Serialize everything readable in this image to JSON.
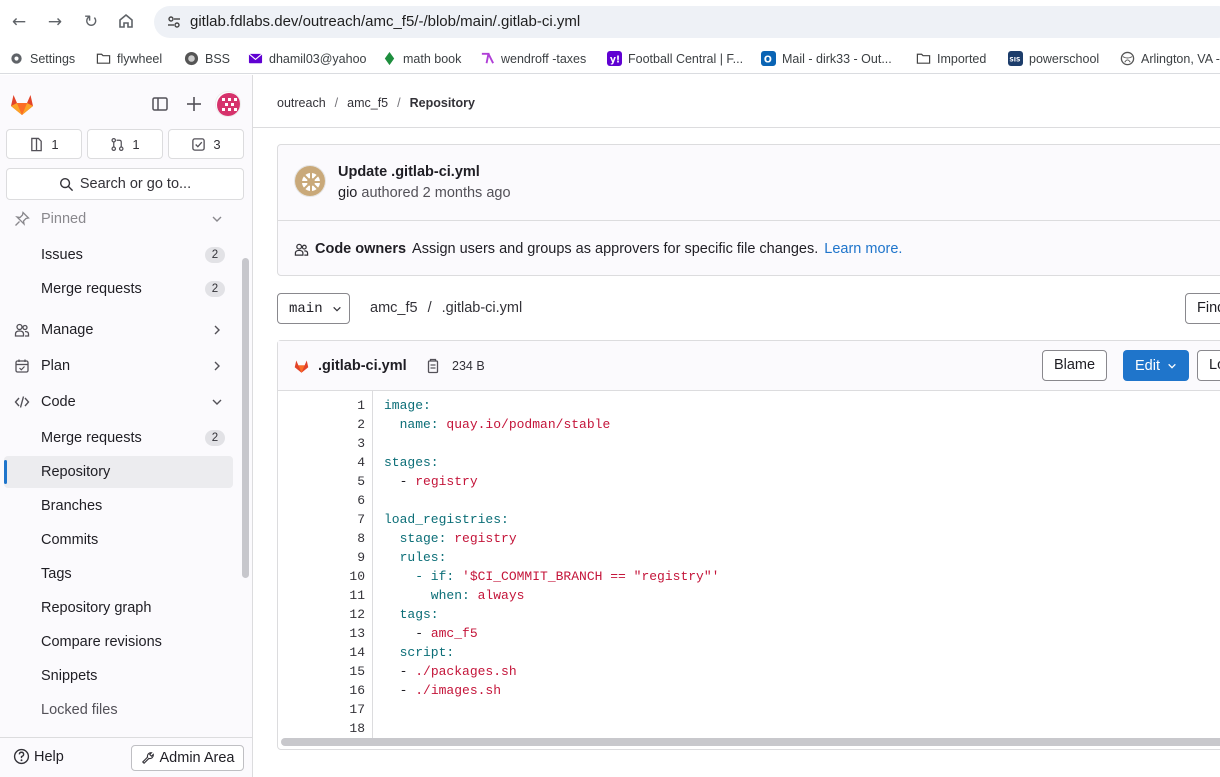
{
  "browser": {
    "url": "gitlab.fdlabs.dev/outreach/amc_f5/-/blob/main/.gitlab-ci.yml",
    "bookmarks": [
      {
        "label": "Settings",
        "icon": "gear-icon"
      },
      {
        "label": "flywheel",
        "icon": "folder-icon"
      },
      {
        "label": "BSS",
        "icon": "bss-icon"
      },
      {
        "label": "dhamil03@yahoo",
        "icon": "mail-icon"
      },
      {
        "label": "math book",
        "icon": "book-icon"
      },
      {
        "label": "wendroff -taxes",
        "icon": "wendroff-icon"
      },
      {
        "label": "Football Central | F...",
        "icon": "yahoo-icon"
      },
      {
        "label": "Mail - dirk33 - Out...",
        "icon": "outlook-icon"
      },
      {
        "label": "Imported",
        "icon": "folder-icon"
      },
      {
        "label": "powerschool",
        "icon": "sis-icon"
      },
      {
        "label": "Arlington, VA -",
        "icon": "globe-icon"
      }
    ]
  },
  "sidebar": {
    "counters": {
      "issues": "1",
      "merge_requests": "1",
      "todos": "3"
    },
    "search_label": "Search or go to...",
    "pinned_label": "Pinned",
    "pinned": [
      {
        "label": "Issues",
        "count": "2"
      },
      {
        "label": "Merge requests",
        "count": "2"
      }
    ],
    "sections": {
      "manage": "Manage",
      "plan": "Plan",
      "code": "Code"
    },
    "code_items": [
      {
        "label": "Merge requests",
        "count": "2"
      },
      {
        "label": "Repository"
      },
      {
        "label": "Branches"
      },
      {
        "label": "Commits"
      },
      {
        "label": "Tags"
      },
      {
        "label": "Repository graph"
      },
      {
        "label": "Compare revisions"
      },
      {
        "label": "Snippets"
      },
      {
        "label": "Locked files"
      }
    ],
    "help": "Help",
    "admin": "Admin Area"
  },
  "breadcrumb": [
    "outreach",
    "amc_f5",
    "Repository"
  ],
  "commit": {
    "title": "Update .gitlab-ci.yml",
    "author": "gio",
    "meta": "authored 2 months ago"
  },
  "code_owners": {
    "label": "Code owners",
    "text": "Assign users and groups as approvers for specific file changes.",
    "link": "Learn more."
  },
  "branch": "main",
  "path": {
    "project": "amc_f5",
    "file": ".gitlab-ci.yml"
  },
  "find_label": "Find",
  "file": {
    "name": ".gitlab-ci.yml",
    "size": "234 B",
    "blame": "Blame",
    "edit": "Edit",
    "lock": "Lock"
  },
  "code_lines": [
    [
      {
        "t": "image:",
        "c": "k"
      }
    ],
    [
      {
        "t": "  name: ",
        "c": "k"
      },
      {
        "t": "quay.io/podman/stable",
        "c": "v"
      }
    ],
    [],
    [
      {
        "t": "stages:",
        "c": "k"
      }
    ],
    [
      {
        "t": "  - ",
        "c": "p"
      },
      {
        "t": "registry",
        "c": "v"
      }
    ],
    [],
    [
      {
        "t": "load_registries:",
        "c": "k"
      }
    ],
    [
      {
        "t": "  stage: ",
        "c": "k"
      },
      {
        "t": "registry",
        "c": "v"
      }
    ],
    [
      {
        "t": "  rules:",
        "c": "k"
      }
    ],
    [
      {
        "t": "    - if: ",
        "c": "k"
      },
      {
        "t": "'$CI_COMMIT_BRANCH == \"registry\"'",
        "c": "v"
      }
    ],
    [
      {
        "t": "      when: ",
        "c": "k"
      },
      {
        "t": "always",
        "c": "v"
      }
    ],
    [
      {
        "t": "  tags:",
        "c": "k"
      }
    ],
    [
      {
        "t": "    - ",
        "c": "p"
      },
      {
        "t": "amc_f5",
        "c": "v"
      }
    ],
    [
      {
        "t": "  script:",
        "c": "k"
      }
    ],
    [
      {
        "t": "  - ",
        "c": "p"
      },
      {
        "t": "./packages.sh",
        "c": "v"
      }
    ],
    [
      {
        "t": "  - ",
        "c": "p"
      },
      {
        "t": "./images.sh",
        "c": "v"
      }
    ],
    [],
    []
  ],
  "colors": {
    "accent": "#1f75cb",
    "key": "#0b6e77",
    "value": "#c4153a",
    "tanuki": "#e24329"
  }
}
